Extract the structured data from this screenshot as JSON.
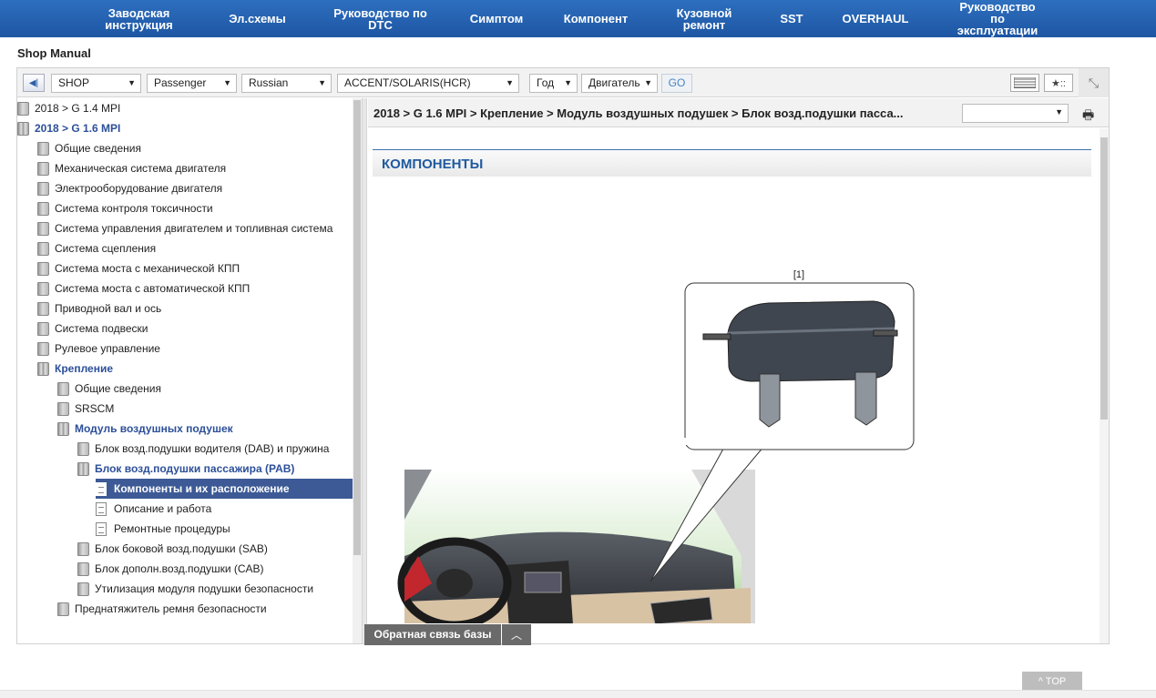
{
  "nav": [
    {
      "label": "Заводская\nинструкция"
    },
    {
      "label": "Эл.схемы"
    },
    {
      "label": "Руководство по\nDTC"
    },
    {
      "label": "Симптом"
    },
    {
      "label": "Компонент"
    },
    {
      "label": "Кузовной\nремонт"
    },
    {
      "label": "SST"
    },
    {
      "label": "OVERHAUL"
    },
    {
      "label": "Руководство\nпо\nэксплуатации"
    }
  ],
  "page_title": "Shop Manual",
  "toolbar": {
    "shop": "SHOP",
    "vehicle_type": "Passenger",
    "language": "Russian",
    "model": "ACCENT/SOLARIS(HCR)",
    "year": "Год",
    "engine": "Двигатель",
    "go": "GO"
  },
  "tree": [
    {
      "label": "2018 > G 1.4 MPI",
      "level": 0,
      "state": "closed"
    },
    {
      "label": "2018 > G 1.6 MPI",
      "level": 0,
      "state": "open"
    },
    {
      "label": "Общие сведения",
      "level": 1,
      "state": "closed"
    },
    {
      "label": "Механическая система двигателя",
      "level": 1,
      "state": "closed"
    },
    {
      "label": "Электрооборудование двигателя",
      "level": 1,
      "state": "closed"
    },
    {
      "label": "Система контроля токсичности",
      "level": 1,
      "state": "closed"
    },
    {
      "label": "Система управления двигателем и топливная система",
      "level": 1,
      "state": "closed"
    },
    {
      "label": "Система сцепления",
      "level": 1,
      "state": "closed"
    },
    {
      "label": "Система моста с механической КПП",
      "level": 1,
      "state": "closed"
    },
    {
      "label": "Система моста с автоматической КПП",
      "level": 1,
      "state": "closed"
    },
    {
      "label": "Приводной вал и ось",
      "level": 1,
      "state": "closed"
    },
    {
      "label": "Система подвески",
      "level": 1,
      "state": "closed"
    },
    {
      "label": "Рулевое управление",
      "level": 1,
      "state": "closed"
    },
    {
      "label": "Крепление",
      "level": 1,
      "state": "open"
    },
    {
      "label": "Общие сведения",
      "level": 2,
      "state": "closed"
    },
    {
      "label": "SRSCM",
      "level": 2,
      "state": "closed"
    },
    {
      "label": "Модуль воздушных подушек",
      "level": 2,
      "state": "open"
    },
    {
      "label": "Блок возд.подушки водителя (DAB) и пружина",
      "level": 3,
      "state": "closed"
    },
    {
      "label": "Блок возд.подушки пассажира (PAB)",
      "level": 3,
      "state": "open"
    },
    {
      "label": "Компоненты и их расположение",
      "level": 4,
      "state": "selected"
    },
    {
      "label": "Описание и работа",
      "level": 4,
      "state": "doc"
    },
    {
      "label": "Ремонтные процедуры",
      "level": 4,
      "state": "doc"
    },
    {
      "label": "Блок боковой возд.подушки (SAB)",
      "level": 3,
      "state": "closed"
    },
    {
      "label": "Блок дополн.возд.подушки (CAB)",
      "level": 3,
      "state": "closed"
    },
    {
      "label": "Утилизация модуля подушки безопасности",
      "level": 3,
      "state": "closed"
    },
    {
      "label": "Преднатяжитель ремня безопасности",
      "level": 2,
      "state": "closed"
    }
  ],
  "breadcrumb": "2018 > G 1.6 MPI > Крепление > Модуль воздушных подушек > Блок возд.подушки пасса...",
  "section_title": "КОМПОНЕНТЫ",
  "figure_callout": "[1]",
  "feedback_button": "Обратная связь базы",
  "top_button": "TOP",
  "colors": {
    "nav_bg": "#1d56a3",
    "tree_selected": "#3d5a96",
    "section_title": "#1f5aa0"
  }
}
